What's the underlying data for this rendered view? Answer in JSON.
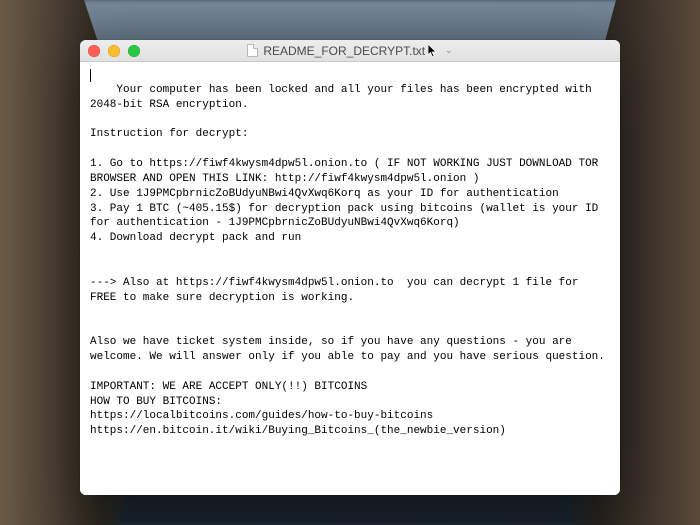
{
  "window": {
    "title": "README_FOR_DECRYPT.txt",
    "dropdown_glyph": "⌄"
  },
  "document": {
    "lines": [
      "Your computer has been locked and all your files has been encrypted with 2048-bit RSA encryption.",
      "",
      "Instruction for decrypt:",
      "",
      "1. Go to https://fiwf4kwysm4dpw5l.onion.to ( IF NOT WORKING JUST DOWNLOAD TOR BROWSER AND OPEN THIS LINK: http://fiwf4kwysm4dpw5l.onion )",
      "2. Use 1J9PMCpbrnicZoBUdyuNBwi4QvXwq6Korq as your ID for authentication",
      "3. Pay 1 BTC (~405.15$) for decryption pack using bitcoins (wallet is your ID for authentication - 1J9PMCpbrnicZoBUdyuNBwi4QvXwq6Korq)",
      "4. Download decrypt pack and run",
      "",
      "",
      "---> Also at https://fiwf4kwysm4dpw5l.onion.to  you can decrypt 1 file for FREE to make sure decryption is working.",
      "",
      "",
      "Also we have ticket system inside, so if you have any questions - you are welcome. We will answer only if you able to pay and you have serious question.",
      "",
      "IMPORTANT: WE ARE ACCEPT ONLY(!!) BITCOINS",
      "HOW TO BUY BITCOINS:",
      "https://localbitcoins.com/guides/how-to-buy-bitcoins",
      "https://en.bitcoin.it/wiki/Buying_Bitcoins_(the_newbie_version)"
    ]
  }
}
